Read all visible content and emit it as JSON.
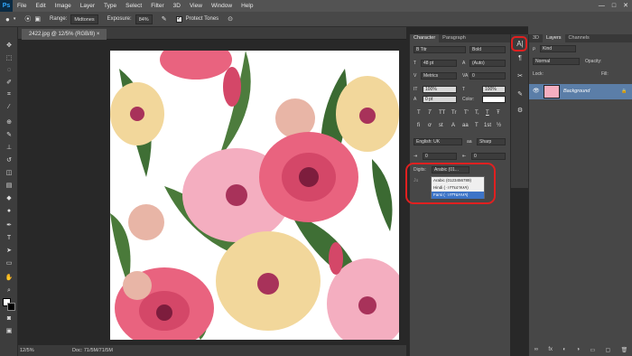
{
  "app": {
    "logo": "Ps"
  },
  "menu": [
    "File",
    "Edit",
    "Image",
    "Layer",
    "Type",
    "Select",
    "Filter",
    "3D",
    "View",
    "Window",
    "Help"
  ],
  "window_controls": [
    "—",
    "□",
    "✕"
  ],
  "options_bar": {
    "range_label": "Range:",
    "range_value": "Midtones",
    "exposure_label": "Exposure:",
    "exposure_value": "84%",
    "protect_tones": "Protect Tones",
    "workspace": "3D"
  },
  "document": {
    "tab_title": "2422.jpg @ 12/5% (RGB/8)",
    "zoom": "12/5%",
    "doc_size": "Doc: 71/5M/71/5M"
  },
  "character_panel": {
    "tabs": [
      "Character",
      "Paragraph"
    ],
    "font_family": "B Titr",
    "font_style": "Bold",
    "font_size": "48 pt",
    "leading": "(Auto)",
    "kerning": "Metrics",
    "tracking": "0",
    "vertical_scale": "100%",
    "horizontal_scale": "100%",
    "baseline_shift": "0 pt",
    "color_label": "Color:",
    "style_buttons": [
      "T",
      "T",
      "TT",
      "Tr",
      "T'",
      "T,",
      "T",
      "Ŧ"
    ],
    "opentype_buttons": [
      "fi",
      "ơ",
      "st",
      "A",
      "aa",
      "T",
      "1st",
      "½"
    ],
    "language": "English: UK",
    "antialias": "Sharp",
    "paragraph_left": "0",
    "paragraph_right": "0",
    "digits_label": "Digits:",
    "digits_value": "Arabic (01...",
    "justify_label": "Ju"
  },
  "digits_dropdown": {
    "options": [
      "Arabic (0123456789)",
      "Hindi (٠١٢٣٤٥٦٧٨٩)",
      "Farsi (۰۱۲۳۴۵۶۷۸۹)"
    ],
    "selected_index": 2
  },
  "layers_panel": {
    "tabs": [
      "3D",
      "Layers",
      "Channels"
    ],
    "filter_kind": "Kind",
    "blend_mode": "Normal",
    "opacity_label": "Opacity:",
    "lock_label": "Lock:",
    "fill_label": "Fill:",
    "layer_name": "Background"
  },
  "colors": {
    "highlight": "#e02020",
    "selection": "#3d74c7",
    "layer_selected": "#5b7ea8"
  }
}
